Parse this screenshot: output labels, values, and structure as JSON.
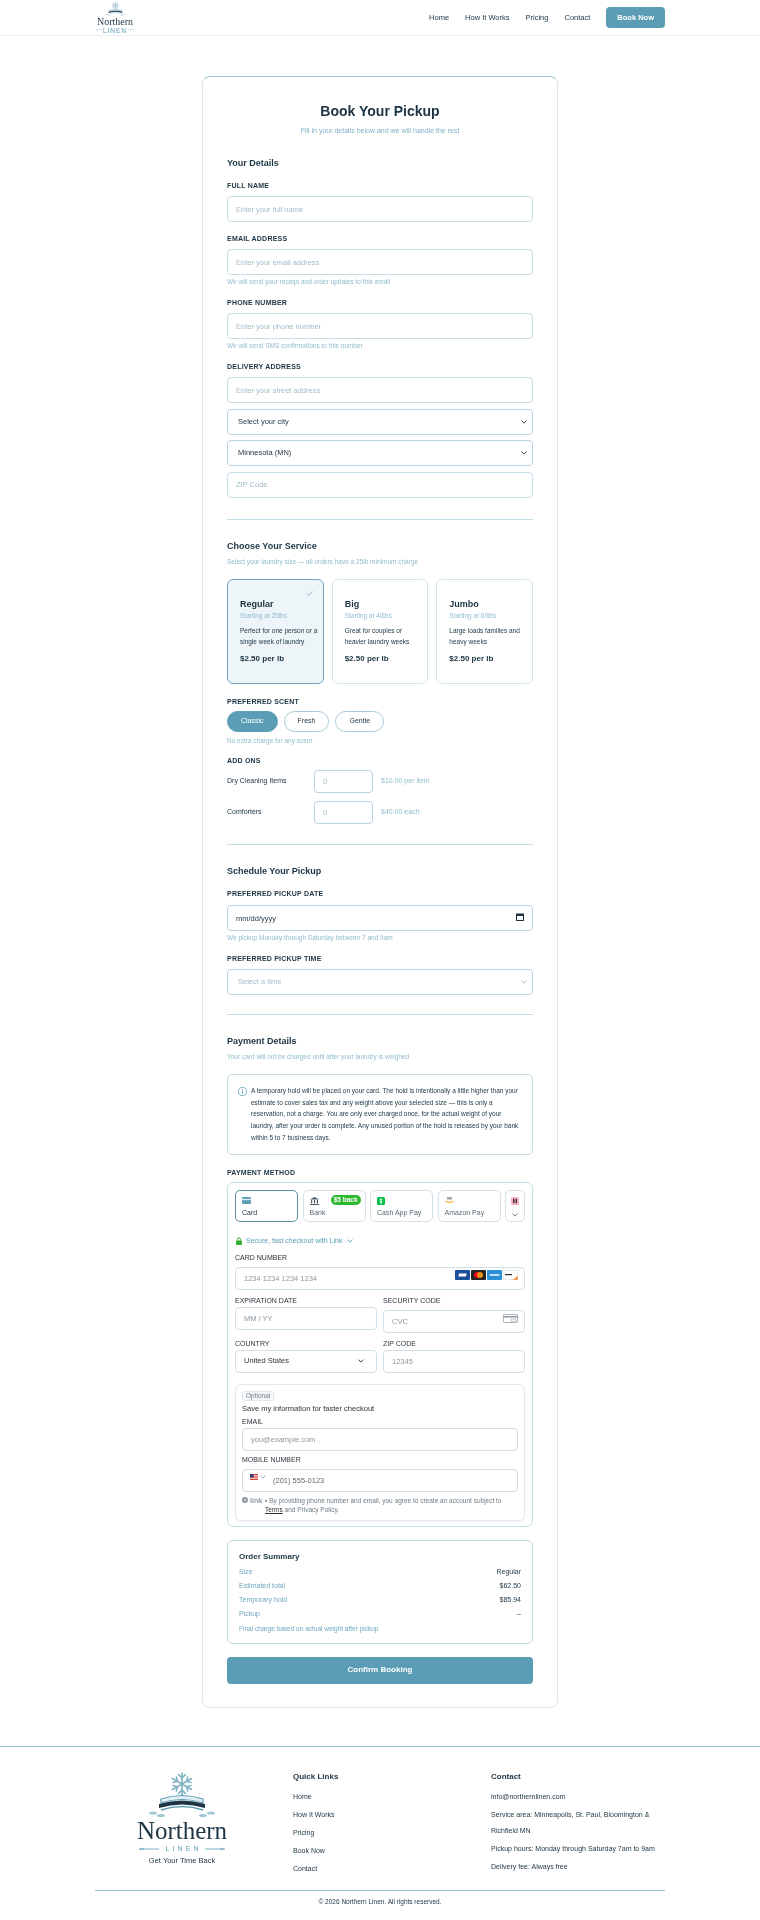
{
  "header": {
    "logo": {
      "wordmark": "Northern",
      "subtitle": "LINEN"
    },
    "nav": [
      {
        "label": "Home"
      },
      {
        "label": "How It Works"
      },
      {
        "label": "Pricing"
      },
      {
        "label": "Contact"
      }
    ],
    "cta": "Book Now"
  },
  "booking_form": {
    "title": "Book Your Pickup",
    "subtitle": "Fill in your details below and we will handle the rest",
    "details": {
      "heading": "Your Details",
      "fields": [
        {
          "label": "FULL NAME",
          "inputs": [
            {
              "kind": "text",
              "placeholder": "Enter your full name"
            }
          ]
        },
        {
          "label": "EMAIL ADDRESS",
          "inputs": [
            {
              "kind": "text",
              "placeholder": "Enter your email address"
            }
          ],
          "hint": "We will send your receipt and order updates to this email"
        },
        {
          "label": "PHONE NUMBER",
          "inputs": [
            {
              "kind": "text",
              "placeholder": "Enter your phone number"
            }
          ],
          "hint": "We will send SMS confirmations to this number"
        },
        {
          "label": "DELIVERY ADDRESS",
          "inputs": [
            {
              "kind": "text",
              "placeholder": "Enter your street address"
            },
            {
              "kind": "select",
              "value": "Select your city"
            },
            {
              "kind": "select",
              "value": "Minnesota (MN)"
            },
            {
              "kind": "text",
              "placeholder": "ZIP Code"
            }
          ]
        }
      ]
    },
    "service": {
      "heading": "Choose Your Service",
      "subtitle": "Select your laundry size — all orders have a 25lb minimum charge",
      "options": [
        {
          "name": "Regular",
          "starting": "Starting at 25lbs",
          "description": "Perfect for one person or a single week of laundry",
          "price": "$2.50 per lb",
          "selected": true
        },
        {
          "name": "Big",
          "starting": "Starting at 40lbs",
          "description": "Great for couples or heavier laundry weeks",
          "price": "$2.50 per lb",
          "selected": false
        },
        {
          "name": "Jumbo",
          "starting": "Starting at 60lbs",
          "description": "Large loads families and heavy weeks",
          "price": "$2.50 per lb",
          "selected": false
        }
      ],
      "scent": {
        "label": "PREFERRED SCENT",
        "options": [
          {
            "label": "Classic",
            "selected": true
          },
          {
            "label": "Fresh",
            "selected": false
          },
          {
            "label": "Gentle",
            "selected": false
          }
        ],
        "hint": "No extra charge for any scent"
      },
      "addons": {
        "label": "ADD ONS",
        "items": [
          {
            "name": "Dry Cleaning Items",
            "placeholder": "0",
            "price": "$10.00 per item"
          },
          {
            "name": "Comforters",
            "placeholder": "0",
            "price": "$40.00 each"
          }
        ]
      }
    },
    "schedule": {
      "heading": "Schedule Your Pickup",
      "fields": [
        {
          "label": "PREFERRED PICKUP DATE",
          "inputs": [
            {
              "kind": "date",
              "placeholder": "mm/dd/yyyy"
            }
          ],
          "hint": "We pickup Monday through Saturday between 7 and 9am"
        },
        {
          "label": "PREFERRED PICKUP TIME",
          "inputs": [
            {
              "kind": "select",
              "placeholder": "Select a time"
            }
          ]
        }
      ]
    },
    "payment": {
      "heading": "Payment Details",
      "subtitle": "Your card will not be charged until after your laundry is weighed",
      "notice": "A temporary hold will be placed on your card. The hold is intentionally a little higher than your estimate to cover sales tax and any weight above your selected size — this is only a reservation, not a charge. You are only ever charged once, for the actual weight of your laundry, after your order is complete. Any unused portion of the hold is released by your bank within 5 to 7 business days.",
      "method_label": "PAYMENT METHOD",
      "methods": [
        {
          "kind": "card",
          "label": "Card",
          "selected": true
        },
        {
          "kind": "bank",
          "label": "Bank",
          "badge": "$5 back",
          "selected": false
        },
        {
          "kind": "cashapp",
          "label": "Cash App Pay",
          "selected": false
        },
        {
          "kind": "amazon",
          "label": "Amazon Pay",
          "selected": false
        },
        {
          "kind": "more",
          "selected": false
        }
      ],
      "link_toggle": "Secure, fast checkout with Link",
      "card_fields": [
        [
          {
            "kind": "card",
            "label": "CARD NUMBER",
            "placeholder": "1234 1234 1234 1234"
          }
        ],
        [
          {
            "kind": "text",
            "label": "EXPIRATION DATE",
            "placeholder": "MM / YY"
          },
          {
            "kind": "cvc",
            "label": "SECURITY CODE",
            "placeholder": "CVC"
          }
        ],
        [
          {
            "kind": "select",
            "label": "COUNTRY",
            "value": "United States"
          },
          {
            "kind": "text",
            "label": "ZIP CODE",
            "placeholder": "12345"
          }
        ]
      ],
      "save_info": {
        "badge": "Optional",
        "title": "Save my information for faster checkout",
        "fields": [
          {
            "kind": "email",
            "label": "EMAIL",
            "placeholder": "you@example.com"
          },
          {
            "kind": "phone",
            "label": "MOBILE NUMBER",
            "placeholder": "(201) 555-0123"
          }
        ],
        "brand": "link",
        "legal": "• By providing phone number and email, you agree to create an account subject to",
        "terms_link": "Terms",
        "legal_end": "and Privacy Policy."
      }
    },
    "summary": {
      "title": "Order Summary",
      "rows": [
        {
          "label": "Size",
          "value": "Regular"
        },
        {
          "label": "Estimated total",
          "value": "$62.50"
        },
        {
          "label": "Temporary hold",
          "value": "$85.94"
        },
        {
          "label": "Pickup",
          "value": "–"
        }
      ],
      "note": "Final charge based on actual weight after pickup"
    },
    "submit": "Confirm Booking"
  },
  "footer": {
    "logo": {
      "wordmark": "Northern",
      "subtitle": "LINEN",
      "tagline": "Get Your Time Back"
    },
    "quick_links": {
      "heading": "Quick Links",
      "links": [
        "Home",
        "How It Works",
        "Pricing",
        "Book Now",
        "Contact"
      ]
    },
    "contact": {
      "heading": "Contact",
      "lines": [
        "info@northernlinen.com",
        "Service area: Minneapolis, St. Paul, Bloomington & Richfield MN",
        "Pickup hours: Monday through Saturday 7am to 9am",
        "Delivery fee: Always free"
      ]
    },
    "copyright": "© 2026 Northern Linen. All rights reserved."
  }
}
